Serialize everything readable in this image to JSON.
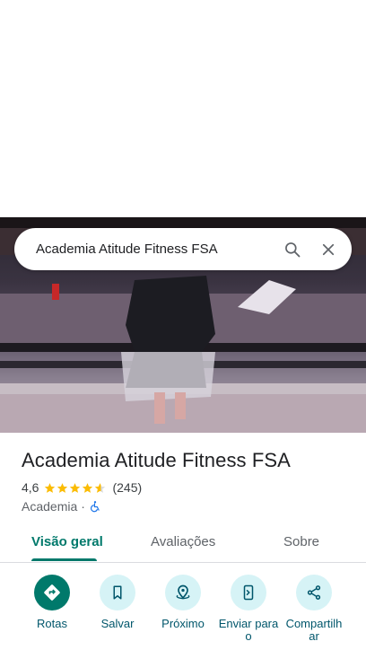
{
  "search": {
    "query": "Academia Atitude Fitness FSA"
  },
  "place": {
    "name": "Academia Atitude Fitness FSA",
    "rating": "4,6",
    "rating_value": 4.6,
    "reviews": "(245)",
    "category": "Academia",
    "separator": "·"
  },
  "tabs": [
    {
      "label": "Visão geral",
      "active": true
    },
    {
      "label": "Avaliações",
      "active": false
    },
    {
      "label": "Sobre",
      "active": false
    }
  ],
  "actions": [
    {
      "label": "Rotas",
      "icon": "directions-icon"
    },
    {
      "label": "Salvar",
      "icon": "bookmark-icon"
    },
    {
      "label": "Próximo",
      "icon": "nearby-icon"
    },
    {
      "label": "Enviar para o",
      "icon": "send-to-phone-icon"
    },
    {
      "label": "Compartilhar",
      "icon": "share-icon"
    }
  ],
  "colors": {
    "accent": "#00796b",
    "star": "#fbbc04",
    "action_bg": "#d6f3f6"
  }
}
